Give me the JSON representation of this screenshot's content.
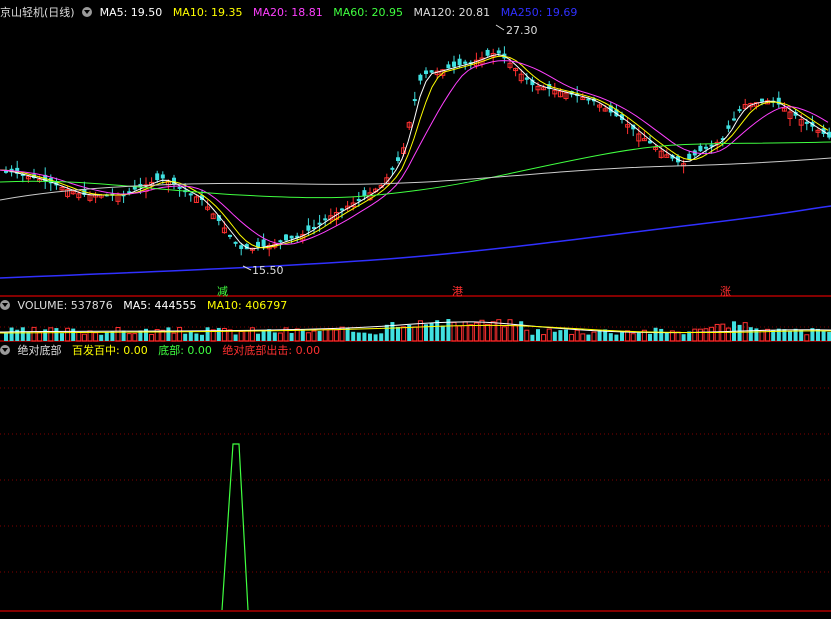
{
  "main": {
    "title": "京山轻机(日线)",
    "ma": [
      {
        "label": "MA5: 19.50",
        "color": "#ffffff"
      },
      {
        "label": "MA10: 19.35",
        "color": "#ffff00"
      },
      {
        "label": "MA20: 18.81",
        "color": "#ff40ff"
      },
      {
        "label": "MA60: 20.95",
        "color": "#40ff40"
      },
      {
        "label": "MA120: 20.81",
        "color": "#dddddd"
      },
      {
        "label": "MA250: 19.69",
        "color": "#3030ff"
      }
    ],
    "high_label": "27.30",
    "low_label": "15.50",
    "markers": [
      "减",
      "港",
      "涨"
    ]
  },
  "volume": {
    "name": "VOLUME: 537876",
    "ma5": "MA5: 444555",
    "ma10": "MA10: 406797"
  },
  "indicator": {
    "name": "绝对底部",
    "a": "百发百中: 0.00",
    "b": "底部: 0.00",
    "c": "绝对底部出击: 0.00"
  },
  "colors": {
    "up": "#ff3030",
    "down": "#40e0e0",
    "grid": "#800000"
  }
}
